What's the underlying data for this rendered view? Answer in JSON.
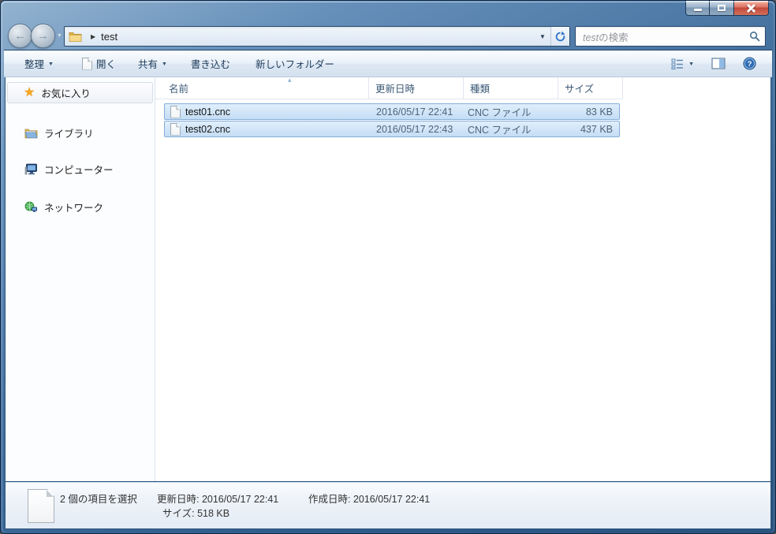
{
  "window": {
    "controls": {
      "minimize": "minimize",
      "maximize": "maximize",
      "close": "close"
    }
  },
  "navigation": {
    "breadcrumb_folder": "test",
    "search_term": "test",
    "search_suffix": "の検索"
  },
  "toolbar": {
    "organize": "整理",
    "open": "開く",
    "share": "共有",
    "burn": "書き込む",
    "new_folder": "新しいフォルダー"
  },
  "sidebar": {
    "items": [
      {
        "label": "お気に入り",
        "icon": "star-icon"
      },
      {
        "label": "ライブラリ",
        "icon": "libraries-icon"
      },
      {
        "label": "コンピューター",
        "icon": "computer-icon"
      },
      {
        "label": "ネットワーク",
        "icon": "network-icon"
      }
    ]
  },
  "file_list": {
    "columns": [
      "名前",
      "更新日時",
      "種類",
      "サイズ"
    ],
    "rows": [
      {
        "name": "test01.cnc",
        "modified": "2016/05/17 22:41",
        "type": "CNC ファイル",
        "size": "83 KB",
        "selected": true
      },
      {
        "name": "test02.cnc",
        "modified": "2016/05/17 22:43",
        "type": "CNC ファイル",
        "size": "437 KB",
        "selected": true
      }
    ]
  },
  "status_bar": {
    "selection": "2 個の項目を選択",
    "modified": "更新日時: 2016/05/17 22:41",
    "created": "作成日時: 2016/05/17 22:41",
    "size": "サイズ: 518 KB"
  },
  "colors": {
    "frame_blue": "#2f5d8c",
    "selection_border": "#84add9",
    "selection_fill_top": "#e0effc",
    "selection_fill_bottom": "#c4ddf4",
    "close_button_red": "#c2473a",
    "toolbar_text": "#1e3c5a"
  }
}
